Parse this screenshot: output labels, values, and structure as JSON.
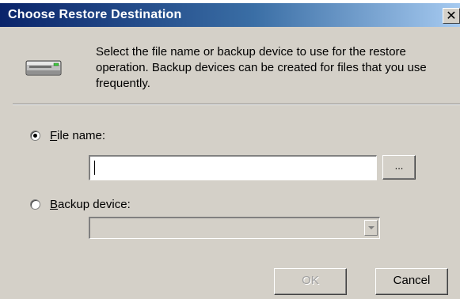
{
  "window": {
    "title": "Choose Restore Destination",
    "close_glyph": "✕"
  },
  "intro": {
    "icon": "backup-device-icon",
    "text": "Select the file name or backup device to use for the restore operation.  Backup devices can be created for files that you use frequently."
  },
  "file_name": {
    "mnemonic": "F",
    "label_rest": "ile name:",
    "selected": true,
    "value": "",
    "browse_label": "..."
  },
  "backup_device": {
    "mnemonic": "B",
    "label_rest": "ackup device:",
    "selected": false,
    "value": ""
  },
  "buttons": {
    "ok": "OK",
    "cancel": "Cancel"
  }
}
